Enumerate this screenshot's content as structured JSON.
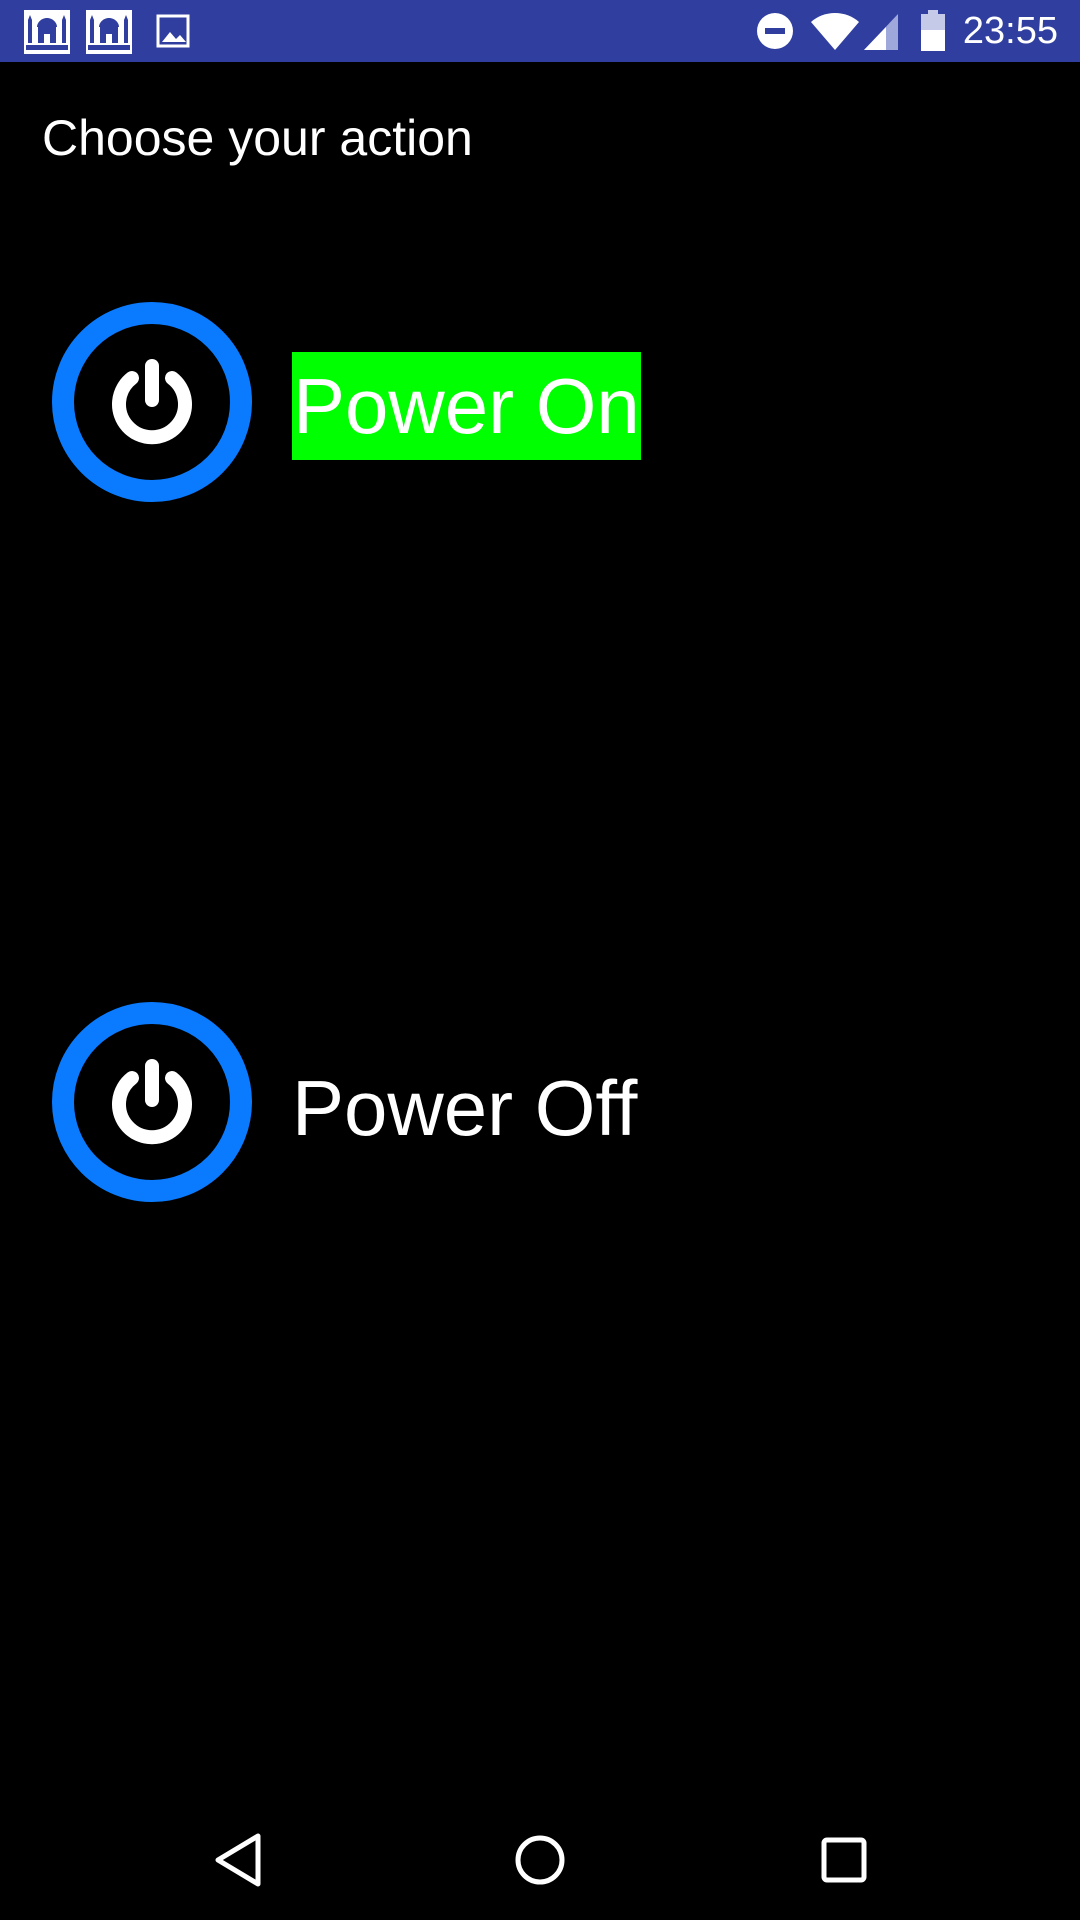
{
  "status_bar": {
    "time": "23:55",
    "left_icons": [
      "mosque-icon",
      "mosque-icon",
      "image-icon"
    ],
    "right_icons": [
      "do-not-disturb-icon",
      "wifi-icon",
      "signal-icon",
      "battery-icon"
    ],
    "color": "#303f9f"
  },
  "page": {
    "title": "Choose your action"
  },
  "actions": [
    {
      "label": "Power On",
      "icon": "power-icon",
      "highlight_color": "#00ff00"
    },
    {
      "label": "Power Off",
      "icon": "power-icon"
    }
  ],
  "colors": {
    "background": "#000000",
    "power_ring": "#0a7bff",
    "text": "#ffffff"
  },
  "nav_bar": {
    "buttons": [
      "back-icon",
      "home-icon",
      "recents-icon"
    ]
  }
}
